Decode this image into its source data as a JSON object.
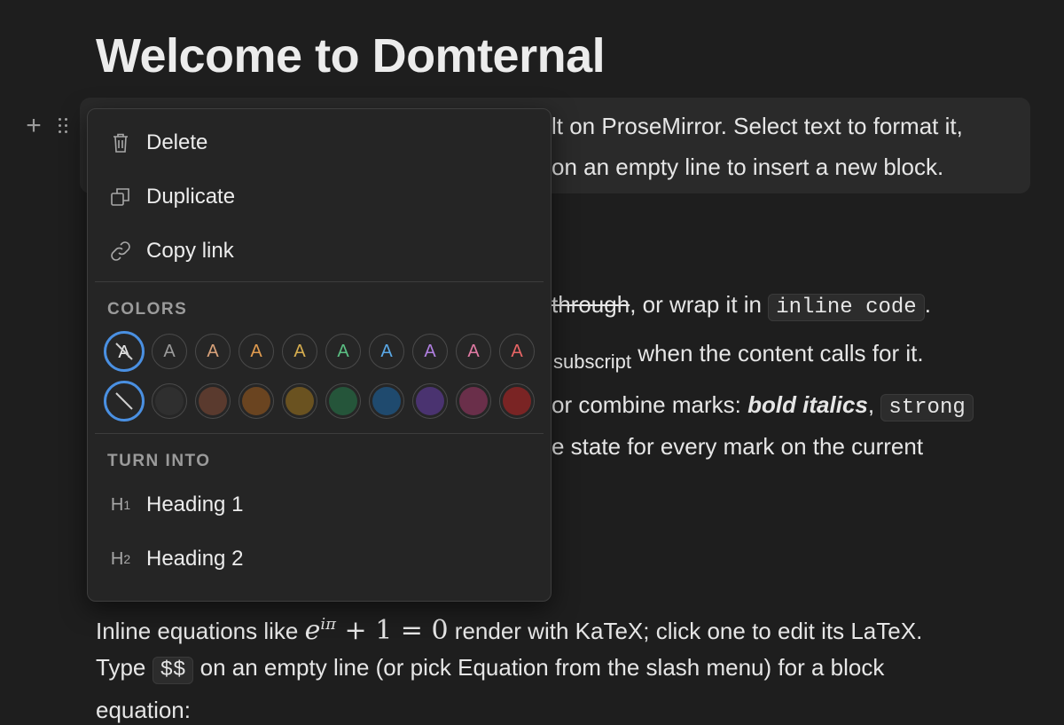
{
  "page": {
    "title": "Welcome to Domternal",
    "para1": {
      "line1": "lt on ProseMirror. Select text to format it,",
      "line2": "on an empty line to insert a new block."
    },
    "para2": {
      "strike_text": "through",
      "after_strike": ", or wrap it in ",
      "inline_code": "inline code",
      "end": "."
    },
    "para3": {
      "sub_text": "subscript",
      "after": " when the content calls for it."
    },
    "para4": {
      "before": "or combine marks: ",
      "bold_italic": "bold italics",
      "comma": ", ",
      "code": "strong"
    },
    "para5": {
      "text": "e state for every mark on the current"
    },
    "equation_para": {
      "before": "Inline equations like ",
      "math_base": "e",
      "math_sup": "iπ",
      "math_rest": "+ 1 = 0",
      "after": " render with KaTeX; click one to edit its LaTeX.",
      "line2_before": "Type ",
      "line2_code": "$$",
      "line2_after": " on an empty line (or pick Equation from the slash menu) for a block",
      "line3": "equation:"
    }
  },
  "gutter": {
    "plus": "+"
  },
  "context_menu": {
    "items": [
      {
        "label": "Delete",
        "icon": "trash-icon"
      },
      {
        "label": "Duplicate",
        "icon": "duplicate-icon"
      },
      {
        "label": "Copy link",
        "icon": "link-icon"
      }
    ],
    "colors_label": "COLORS",
    "text_color_glyph": "A",
    "text_colors": [
      "#e6e6e6",
      "#9b9b9b",
      "#d9a27a",
      "#e09b4f",
      "#d6ad4f",
      "#5bbf83",
      "#5aa8e6",
      "#b07fe0",
      "#e07aa3",
      "#e86565"
    ],
    "background_colors": [
      "#2f2f2f",
      "#5a3a2e",
      "#6a4420",
      "#6a5220",
      "#25553a",
      "#1f4a6e",
      "#4a3370",
      "#6a2f4a",
      "#7a2424"
    ],
    "turn_into_label": "TURN INTO",
    "turn_into": [
      {
        "label": "Heading 1",
        "icon_letter": "H",
        "icon_sub": "1"
      },
      {
        "label": "Heading 2",
        "icon_letter": "H",
        "icon_sub": "2"
      }
    ]
  }
}
